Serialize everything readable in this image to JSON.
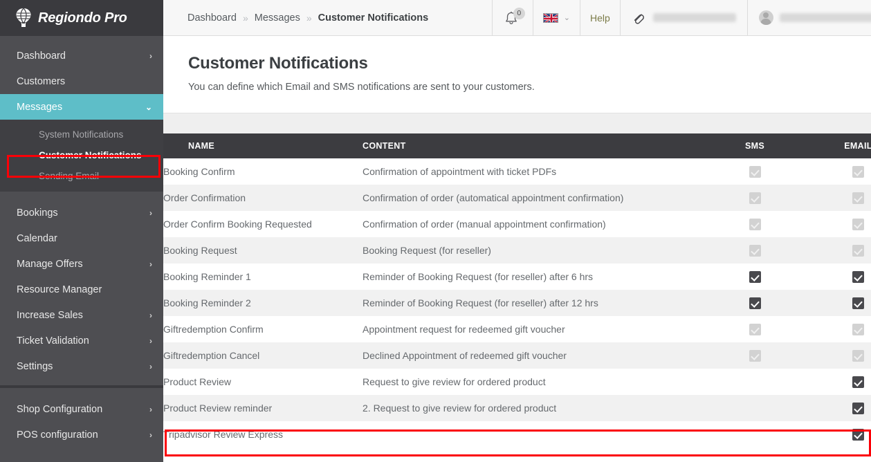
{
  "brand": {
    "name": "Regiondo Pro",
    "logo_icon": "hot-air-balloon-icon"
  },
  "sidebar": {
    "primary": [
      {
        "label": "Dashboard",
        "chevron": "›",
        "has_chevron": true,
        "active": false
      },
      {
        "label": "Customers",
        "chevron": "",
        "has_chevron": false,
        "active": false
      },
      {
        "label": "Messages",
        "chevron": "⌄",
        "has_chevron": true,
        "active": true
      }
    ],
    "submenu": [
      {
        "label": "System Notifications",
        "current": false
      },
      {
        "label": "Customer Notifications",
        "current": true
      },
      {
        "label": "Sending Email",
        "current": false
      }
    ],
    "secondary": [
      {
        "label": "Bookings",
        "chevron": "›",
        "has_chevron": true
      },
      {
        "label": "Calendar",
        "chevron": "",
        "has_chevron": false
      },
      {
        "label": "Manage Offers",
        "chevron": "›",
        "has_chevron": true
      },
      {
        "label": "Resource Manager",
        "chevron": "",
        "has_chevron": false
      },
      {
        "label": "Increase Sales",
        "chevron": "›",
        "has_chevron": true
      },
      {
        "label": "Ticket Validation",
        "chevron": "›",
        "has_chevron": true
      },
      {
        "label": "Settings",
        "chevron": "›",
        "has_chevron": true
      }
    ],
    "tertiary": [
      {
        "label": "Shop Configuration",
        "chevron": "›",
        "has_chevron": true
      },
      {
        "label": "POS configuration",
        "chevron": "›",
        "has_chevron": true
      }
    ]
  },
  "topbar": {
    "breadcrumb": [
      {
        "label": "Dashboard",
        "last": false
      },
      {
        "label": "Messages",
        "last": false
      },
      {
        "label": "Customer Notifications",
        "last": true
      }
    ],
    "breadcrumb_separator": "»",
    "notifications_count": "0",
    "notifications_icon": "bell-icon",
    "language_flag": "uk-flag-icon",
    "language_chevron": "⌄",
    "help_label": "Help",
    "attachment_icon": "paperclip-icon",
    "shop_name_redacted": true,
    "user_name_redacted": true,
    "user_avatar_icon": "user-avatar-icon"
  },
  "page": {
    "title": "Customer Notifications",
    "subtitle": "You can define which Email and SMS notifications are sent to your customers."
  },
  "table": {
    "columns": [
      "NAME",
      "CONTENT",
      "SMS",
      "EMAIL"
    ],
    "rows": [
      {
        "name": "Booking Confirm",
        "content": "Confirmation of appointment with ticket PDFs",
        "sms": "disabled",
        "email": "disabled"
      },
      {
        "name": "Order Confirmation",
        "content": "Confirmation of order (automatical appointment confirmation)",
        "sms": "disabled",
        "email": "disabled"
      },
      {
        "name": "Order Confirm Booking Requested",
        "content": "Confirmation of order (manual appointment confirmation)",
        "sms": "disabled",
        "email": "disabled"
      },
      {
        "name": "Booking Request",
        "content": "Booking Request (for reseller)",
        "sms": "disabled",
        "email": "disabled"
      },
      {
        "name": "Booking Reminder 1",
        "content": "Reminder of Booking Request (for reseller) after 6 hrs",
        "sms": "checked",
        "email": "checked"
      },
      {
        "name": "Booking Reminder 2",
        "content": "Reminder of Booking Request (for reseller) after 12 hrs",
        "sms": "checked",
        "email": "checked"
      },
      {
        "name": "Giftredemption Confirm",
        "content": "Appointment request for redeemed gift voucher",
        "sms": "disabled",
        "email": "disabled"
      },
      {
        "name": "Giftredemption Cancel",
        "content": "Declined Appointment of redeemed gift voucher",
        "sms": "disabled",
        "email": "disabled"
      },
      {
        "name": "Product Review",
        "content": "Request to give review for ordered product",
        "sms": "none",
        "email": "checked"
      },
      {
        "name": "Product Review reminder",
        "content": "2. Request to give review for ordered product",
        "sms": "none",
        "email": "checked"
      },
      {
        "name": "Tripadvisor Review Express",
        "content": "",
        "sms": "none",
        "email": "checked"
      }
    ]
  },
  "annotations": {
    "sidebar_highlight_target": "Customer Notifications",
    "row_highlight_target": "Tripadvisor Review Express",
    "color": "#fb0007"
  },
  "colors": {
    "accent_teal": "#5ebec8",
    "sidebar_bg": "#4e4e52",
    "header_dark": "#3c3c40"
  }
}
